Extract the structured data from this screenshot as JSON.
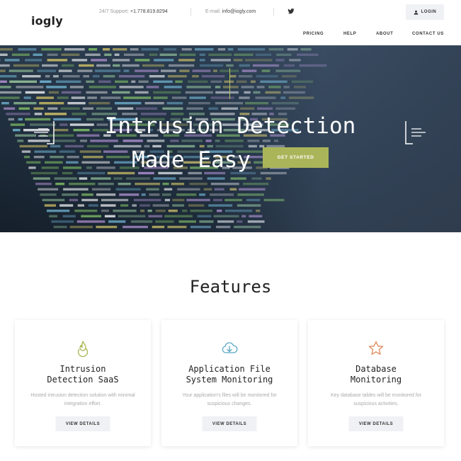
{
  "header": {
    "logo": "iogly",
    "support_label": "24/7 Support:",
    "support_phone": "+1.778.819.8294",
    "email_label": "E-mail:",
    "email_value": "info@iogly.com",
    "login_label": "LOGIN",
    "nav": [
      {
        "label": "PRICING"
      },
      {
        "label": "HELP"
      },
      {
        "label": "ABOUT"
      },
      {
        "label": "CONTACT US"
      }
    ]
  },
  "hero": {
    "title_line1": "Intrusion Detection",
    "title_line2": "Made Easy",
    "cta_label": "GET STARTED"
  },
  "features": {
    "title": "Features",
    "cards": [
      {
        "title_line1": "Intrusion",
        "title_line2": "Detection SaaS",
        "desc": "Hosted intrusion detection solution with minimal integration effort.",
        "button": "VIEW DETAILS",
        "icon": "flame-icon",
        "icon_color": "#a7b54f"
      },
      {
        "title_line1": "Application File",
        "title_line2": "System Monitoring",
        "desc": "Your application's files will be monitored for suspicious changes.",
        "button": "VIEW DETAILS",
        "icon": "cloud-download-icon",
        "icon_color": "#5ba8c4"
      },
      {
        "title_line1": "Database",
        "title_line2": "Monitoring",
        "desc": "Key database tables will be monitored for suspicious activities.",
        "button": "VIEW DETAILS",
        "icon": "star-icon",
        "icon_color": "#e08a5e"
      }
    ]
  },
  "colors": {
    "accent": "#aab55a",
    "hero_bg": "#22303f"
  }
}
